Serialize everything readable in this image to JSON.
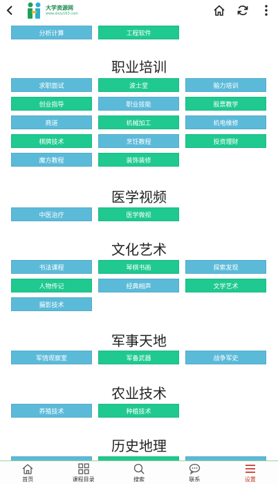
{
  "header": {
    "logo_text": "大学资源网",
    "logo_sub": "www.dxzy163.com",
    "back_icon": "chevron-left-icon",
    "home_icon": "home-icon",
    "refresh_icon": "refresh-icon",
    "menu_icon": "more-vertical-icon"
  },
  "top_row": {
    "items": [
      {
        "label": "分析计算",
        "color": "blue"
      },
      {
        "label": "工程软件",
        "color": "green"
      }
    ]
  },
  "sections": [
    {
      "title": "职业培训",
      "items": [
        {
          "label": "求职面试",
          "color": "blue"
        },
        {
          "label": "波士堂",
          "color": "green"
        },
        {
          "label": "脑力培训",
          "color": "blue"
        },
        {
          "label": "创业指导",
          "color": "green"
        },
        {
          "label": "职业技能",
          "color": "blue"
        },
        {
          "label": "股票教学",
          "color": "green"
        },
        {
          "label": "商道",
          "color": "blue"
        },
        {
          "label": "机械加工",
          "color": "green"
        },
        {
          "label": "机电维修",
          "color": "blue"
        },
        {
          "label": "棋牌技术",
          "color": "green"
        },
        {
          "label": "烹饪教程",
          "color": "blue"
        },
        {
          "label": "投资理财",
          "color": "green"
        },
        {
          "label": "魔方教程",
          "color": "blue"
        },
        {
          "label": "装饰装修",
          "color": "green"
        }
      ]
    },
    {
      "title": "医学视频",
      "items": [
        {
          "label": "中医治疗",
          "color": "blue"
        },
        {
          "label": "医学微视",
          "color": "green"
        }
      ]
    },
    {
      "title": "文化艺术",
      "items": [
        {
          "label": "书法课程",
          "color": "blue"
        },
        {
          "label": "琴棋书画",
          "color": "green"
        },
        {
          "label": "探索发现",
          "color": "blue"
        },
        {
          "label": "人物传记",
          "color": "green"
        },
        {
          "label": "经典相声",
          "color": "blue"
        },
        {
          "label": "文学艺术",
          "color": "green"
        },
        {
          "label": "摄影技术",
          "color": "blue"
        }
      ]
    },
    {
      "title": "军事天地",
      "items": [
        {
          "label": "军情观察室",
          "color": "blue"
        },
        {
          "label": "军备武器",
          "color": "green"
        },
        {
          "label": "战争军史",
          "color": "blue"
        }
      ]
    },
    {
      "title": "农业技术",
      "items": [
        {
          "label": "养殖技术",
          "color": "blue"
        },
        {
          "label": "种植技术",
          "color": "green"
        }
      ]
    },
    {
      "title": "历史地理",
      "items": [
        {
          "label": "",
          "color": "blue"
        },
        {
          "label": "",
          "color": "green"
        },
        {
          "label": "",
          "color": "blue"
        }
      ]
    }
  ],
  "tabbar": {
    "tabs": [
      {
        "label": "首页",
        "icon": "home-icon"
      },
      {
        "label": "课程目录",
        "icon": "grid-icon"
      },
      {
        "label": "搜索",
        "icon": "search-icon"
      },
      {
        "label": "联系",
        "icon": "chat-icon"
      },
      {
        "label": "设置",
        "icon": "menu-icon"
      }
    ],
    "active_tab": "设置"
  },
  "colors": {
    "blue": "#5cbad9",
    "green": "#1fc98f",
    "active": "#c0392b"
  }
}
